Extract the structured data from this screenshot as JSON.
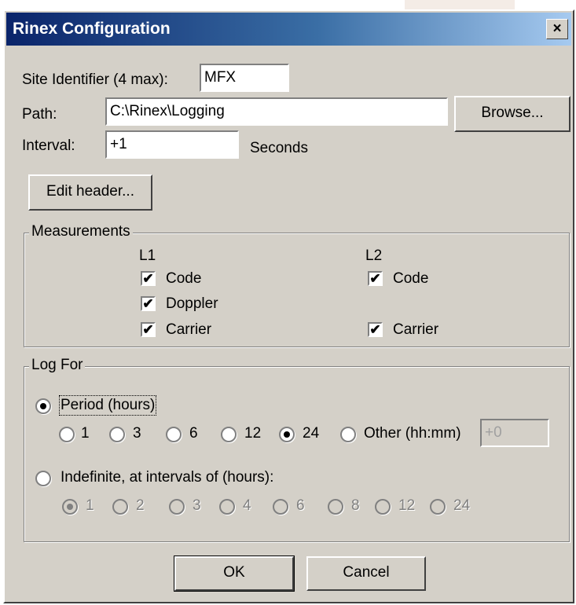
{
  "window": {
    "title": "Rinex Configuration",
    "close_label": "×"
  },
  "site": {
    "label": "Site Identifier (4 max):",
    "value": "MFX"
  },
  "path": {
    "label": "Path:",
    "value": "C:\\Rinex\\Logging",
    "browse_label": "Browse..."
  },
  "interval": {
    "label": "Interval:",
    "value": "+1",
    "unit": "Seconds"
  },
  "edit_header_label": "Edit header...",
  "measurements": {
    "title": "Measurements",
    "l1": {
      "label": "L1",
      "code": "Code",
      "doppler": "Doppler",
      "carrier": "Carrier"
    },
    "l2": {
      "label": "L2",
      "code": "Code",
      "carrier": "Carrier"
    }
  },
  "log_for": {
    "title": "Log For",
    "period_label": "Period (hours)",
    "period_options": [
      "1",
      "3",
      "6",
      "12",
      "24",
      "Other (hh:mm)"
    ],
    "selected_period": "24",
    "other_value": "+0",
    "indefinite_label": "Indefinite, at intervals of (hours):",
    "indefinite_options": [
      "1",
      "2",
      "3",
      "4",
      "6",
      "8",
      "12",
      "24"
    ],
    "selected_indefinite": "1"
  },
  "buttons": {
    "ok": "OK",
    "cancel": "Cancel"
  }
}
